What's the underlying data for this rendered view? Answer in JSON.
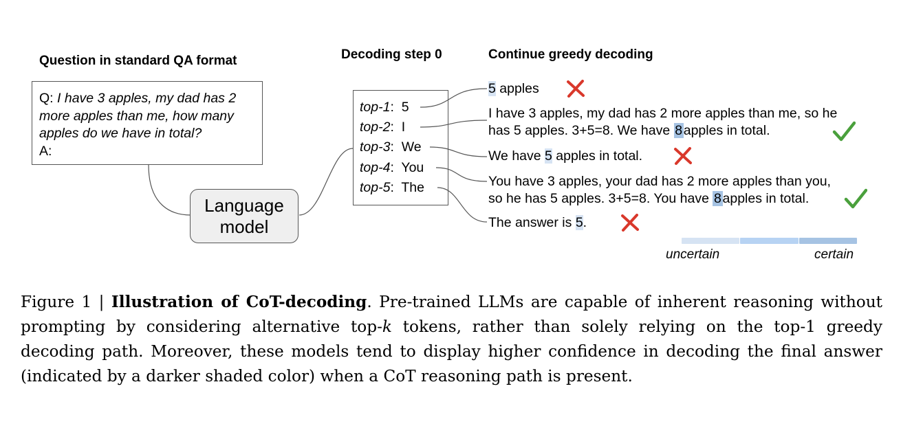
{
  "headings": {
    "question": "Question in standard QA format",
    "decoding_step": "Decoding step 0",
    "continue": "Continue greedy decoding"
  },
  "question_box": {
    "q_prefix": "Q: ",
    "q_line1": "I have 3 apples, my dad has 2",
    "q_line2": "more apples than me, how many",
    "q_line3": "apples do we have in total?",
    "a_prefix": "A:"
  },
  "language_model": {
    "line1": "Language",
    "line2": "model"
  },
  "top_k": [
    {
      "label": "top-1",
      "sep": ":",
      "token": "5"
    },
    {
      "label": "top-2",
      "sep": ":",
      "token": "I"
    },
    {
      "label": "top-3",
      "sep": ":",
      "token": "We"
    },
    {
      "label": "top-4",
      "sep": ":",
      "token": "You"
    },
    {
      "label": "top-5",
      "sep": ":",
      "token": "The"
    }
  ],
  "paths": [
    {
      "pre": "",
      "answer": "5",
      "post": " apples",
      "line2_pre": "",
      "line2_answer": "",
      "line2_post": "",
      "confidence": "low",
      "correct": false
    },
    {
      "line1": "I have 3 apples, my dad has 2 more apples than me, so he",
      "pre": "has 5 apples. 3+5=8. We have",
      "answer": "8",
      "post": "apples in total.",
      "confidence": "high",
      "correct": true
    },
    {
      "pre": "We have ",
      "answer": "5",
      "post": " apples in total.",
      "confidence": "low",
      "correct": false
    },
    {
      "line1": "You have 3 apples, your dad has 2 more apples than you,",
      "pre": "so he has 5 apples. 3+5=8. You have",
      "answer": "8",
      "post": "apples in total.",
      "confidence": "high",
      "correct": true
    },
    {
      "pre": "The answer is ",
      "answer": "5",
      "post": ".",
      "confidence": "low",
      "correct": false
    }
  ],
  "legend": {
    "low_label": "uncertain",
    "high_label": "certain",
    "colors": [
      "#d6e3f3",
      "#b7d3f3",
      "#a6c3e3"
    ]
  },
  "marks": {
    "correct_icon": "check-icon",
    "wrong_icon": "cross-icon",
    "correct_color": "#4aa03c",
    "wrong_color": "#d9382b"
  },
  "caption": {
    "fig": "Figure 1 | ",
    "title": "Illustration of CoT-decoding",
    "t1": ". Pre-trained LLMs are capable of inherent reasoning without prompting by considering alternative top-",
    "k": "k",
    "t2": " tokens, rather than solely relying on the top-1 greedy decoding path. Moreover, these models tend to display higher confidence in decoding the final answer (indicated by a darker shaded color) when a CoT reasoning path is present."
  }
}
